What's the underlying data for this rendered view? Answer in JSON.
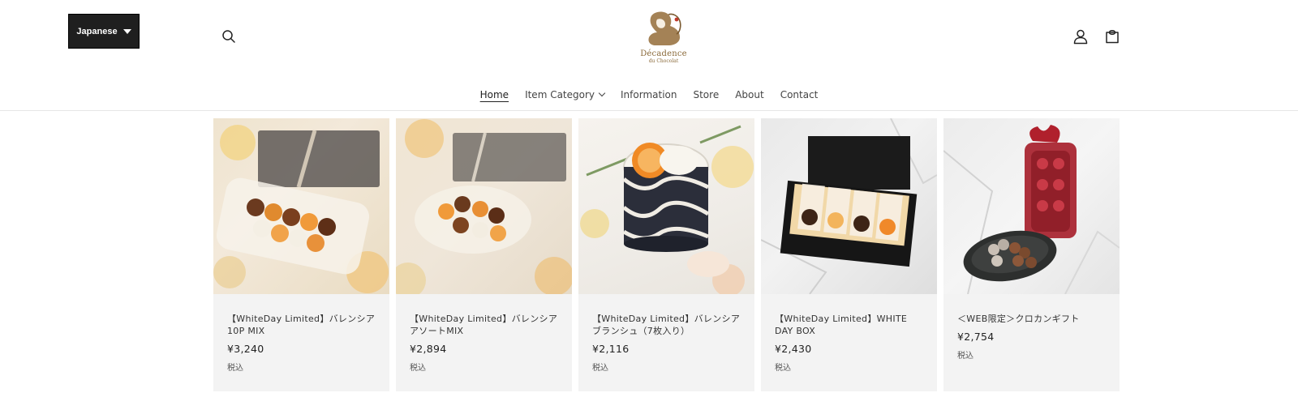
{
  "header": {
    "language": "Japanese",
    "logo": {
      "name": "Décadence",
      "sub": "du Chocolat"
    }
  },
  "nav": {
    "items": [
      {
        "label": "Home",
        "active": true,
        "dropdown": false
      },
      {
        "label": "Item Category",
        "active": false,
        "dropdown": true
      },
      {
        "label": "Information",
        "active": false,
        "dropdown": false
      },
      {
        "label": "Store",
        "active": false,
        "dropdown": false
      },
      {
        "label": "About",
        "active": false,
        "dropdown": false
      },
      {
        "label": "Contact",
        "active": false,
        "dropdown": false
      }
    ]
  },
  "products": [
    {
      "title": "【WhiteDay Limited】バレンシア10P MIX",
      "price": "¥3,240",
      "tax": "税込"
    },
    {
      "title": "【WhiteDay Limited】バレンシアアソートMIX",
      "price": "¥2,894",
      "tax": "税込"
    },
    {
      "title": "【WhiteDay Limited】バレンシアブランシュ（7枚入り）",
      "price": "¥2,116",
      "tax": "税込"
    },
    {
      "title": "【WhiteDay Limited】WHITE DAY BOX",
      "price": "¥2,430",
      "tax": "税込"
    },
    {
      "title": "＜WEB限定＞クロカンギフト",
      "price": "¥2,754",
      "tax": "税込"
    }
  ],
  "icons": {
    "search": "search-icon",
    "account": "account-icon",
    "cart": "cart-icon",
    "language_caret": "caret-down-icon",
    "nav_dropdown": "chevron-down-icon"
  },
  "colors": {
    "language_button_bg": "#1f1f1f",
    "card_bg": "#f3f3f3",
    "logo_gold": "#8a6a3a"
  }
}
